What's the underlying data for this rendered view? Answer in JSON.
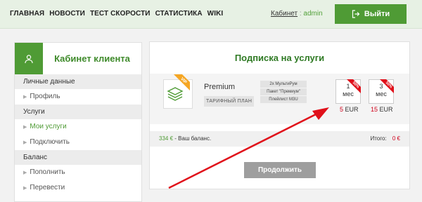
{
  "nav": {
    "items": [
      "ГЛАВНАЯ",
      "НОВОСТИ",
      "ТЕСТ СКОРОСТИ",
      "СТАТИСТИКА",
      "WIKI"
    ],
    "cabinet_link": "Кабинет",
    "separator": ":",
    "username": "admin",
    "logout_label": "Выйти"
  },
  "sidebar": {
    "title": "Кабинет клиента",
    "groups": [
      {
        "label": "Личные данные",
        "items": [
          {
            "label": "Профиль",
            "active": false
          }
        ]
      },
      {
        "label": "Услуги",
        "items": [
          {
            "label": "Мои услуги",
            "active": true
          },
          {
            "label": "Подключить",
            "active": false
          }
        ]
      },
      {
        "label": "Баланс",
        "items": [
          {
            "label": "Пополнить",
            "active": false
          },
          {
            "label": "Перевести",
            "active": false
          }
        ]
      }
    ]
  },
  "panel": {
    "title": "Подписка на услуги",
    "product": {
      "badge": "VIP",
      "name": "Premium",
      "plan": "ТАРИФНЫЙ ПЛАН",
      "features": [
        "2х МультиРум",
        "Пакет \"Премиум\"",
        "Плейлист M3U"
      ]
    },
    "options": [
      {
        "num": "1",
        "unit": "мес",
        "discount": "50%",
        "price": "5",
        "currency": "EUR"
      },
      {
        "num": "3",
        "unit": "мес",
        "discount": "50%",
        "price": "15",
        "currency": "EUR"
      }
    ],
    "balance_amount": "334 €",
    "balance_text": "- Ваш баланс.",
    "total_label": "Итого:",
    "total_value": "0 €",
    "continue_label": "Продолжить"
  },
  "colors": {
    "brand_green": "#4f9b35",
    "price_red": "#d0021b",
    "annotation_red": "#e0101a"
  }
}
